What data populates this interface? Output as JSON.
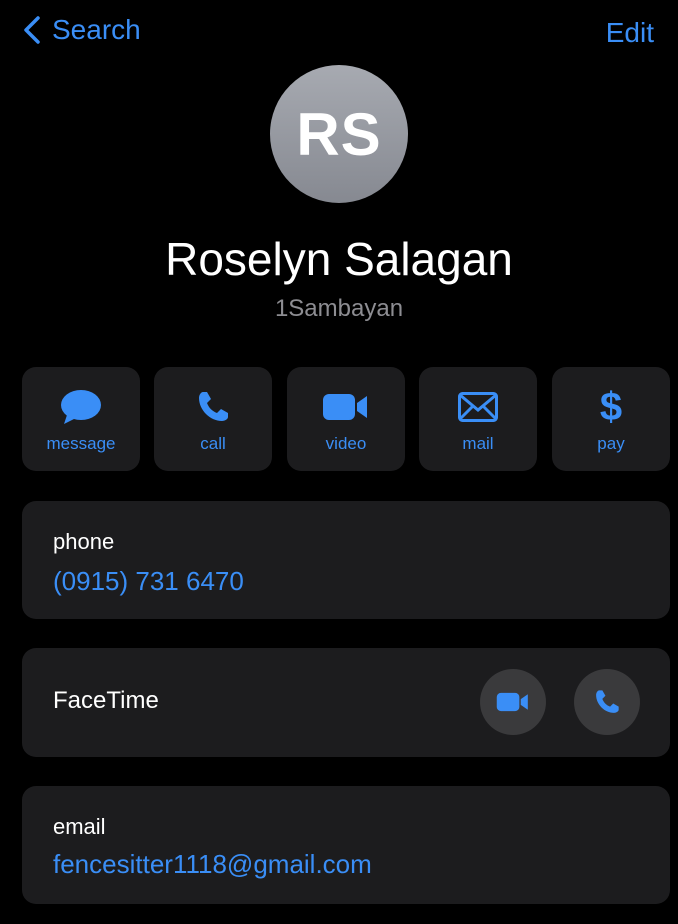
{
  "nav": {
    "back_label": "Search",
    "edit_label": "Edit"
  },
  "contact": {
    "initials": "RS",
    "name": "Roselyn Salagan",
    "subtitle": "1Sambayan"
  },
  "actions": [
    {
      "label": "message",
      "icon": "message-bubble-icon"
    },
    {
      "label": "call",
      "icon": "phone-icon"
    },
    {
      "label": "video",
      "icon": "video-camera-icon"
    },
    {
      "label": "mail",
      "icon": "envelope-icon"
    },
    {
      "label": "pay",
      "icon": "dollar-icon"
    }
  ],
  "phone": {
    "label": "phone",
    "value": "(0915) 731 6470"
  },
  "facetime": {
    "label": "FaceTime"
  },
  "email": {
    "label": "email",
    "value": "fencesitter1118@gmail.com"
  },
  "colors": {
    "accent": "#3a8ef6",
    "background": "#000000",
    "card": "#1c1c1e",
    "secondary_text": "#8d8d92"
  }
}
